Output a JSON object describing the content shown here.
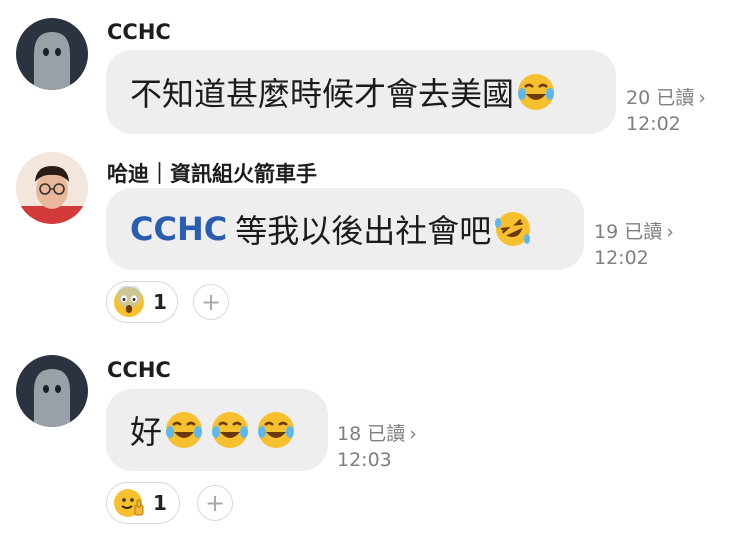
{
  "messages": [
    {
      "sender": "CCHC",
      "text": "不知道甚麼時候才會去美國",
      "read": "20 已讀",
      "time": "12:02",
      "emoji": [
        "face-with-tears-of-joy"
      ]
    },
    {
      "sender": "哈迪｜資訊組火箭車手",
      "mention": "CCHC",
      "text": "等我以後出社會吧",
      "read": "19 已讀",
      "time": "12:02",
      "emoji": [
        "rolling-on-floor-laughing"
      ],
      "reaction": {
        "emoji": "face-screaming-in-fear",
        "count": "1"
      }
    },
    {
      "sender": "CCHC",
      "text": "好",
      "read": "18 已讀",
      "time": "12:03",
      "emoji": [
        "face-with-tears-of-joy",
        "face-with-tears-of-joy",
        "face-with-tears-of-joy"
      ],
      "reaction": {
        "emoji": "thumbs-up-face",
        "count": "1"
      }
    }
  ],
  "chevron": "›",
  "add_reaction": "+",
  "colors": {
    "bubble": "#eeeeef",
    "mention": "#2a5db0",
    "meta": "#7f7f7f"
  }
}
